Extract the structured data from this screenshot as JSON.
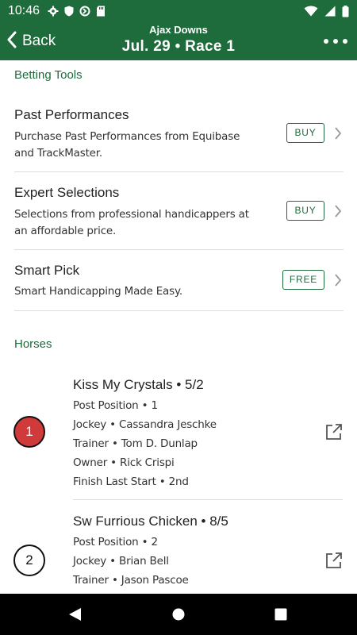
{
  "status_bar": {
    "time": "10:46",
    "icons_left": [
      "gear-icon",
      "shield-icon",
      "vpn-icon",
      "sd-card-icon"
    ],
    "icons_right": [
      "wifi-icon",
      "signal-icon",
      "battery-icon"
    ]
  },
  "app_bar": {
    "back_label": "Back",
    "subtitle": "Ajax Downs",
    "title": "Jul. 29 • Race 1",
    "colors": {
      "primary": "#1e6b3c"
    }
  },
  "betting_tools": {
    "header": "Betting Tools",
    "items": [
      {
        "title": "Past Performances",
        "desc": "Purchase Past Performances from Equibase and TrackMaster.",
        "badge": "BUY"
      },
      {
        "title": "Expert Selections",
        "desc": "Selections from professional handicappers at an affordable price.",
        "badge": "BUY"
      },
      {
        "title": "Smart Pick",
        "desc": "Smart Handicapping Made Easy.",
        "badge": "FREE"
      }
    ]
  },
  "horses": {
    "header": "Horses",
    "items": [
      {
        "number": "1",
        "color": "#d03a3a",
        "name": "Kiss My Crystals • 5/2",
        "lines": [
          "Post Position • 1",
          "Jockey • Cassandra Jeschke",
          "Trainer • Tom D. Dunlap",
          "Owner • Rick Crispi",
          "Finish Last Start • 2nd"
        ]
      },
      {
        "number": "2",
        "color": "#ffffff",
        "name": "Sw Furrious Chicken • 8/5",
        "lines": [
          "Post Position • 2",
          "Jockey • Brian Bell",
          "Trainer • Jason Pascoe"
        ]
      }
    ]
  }
}
